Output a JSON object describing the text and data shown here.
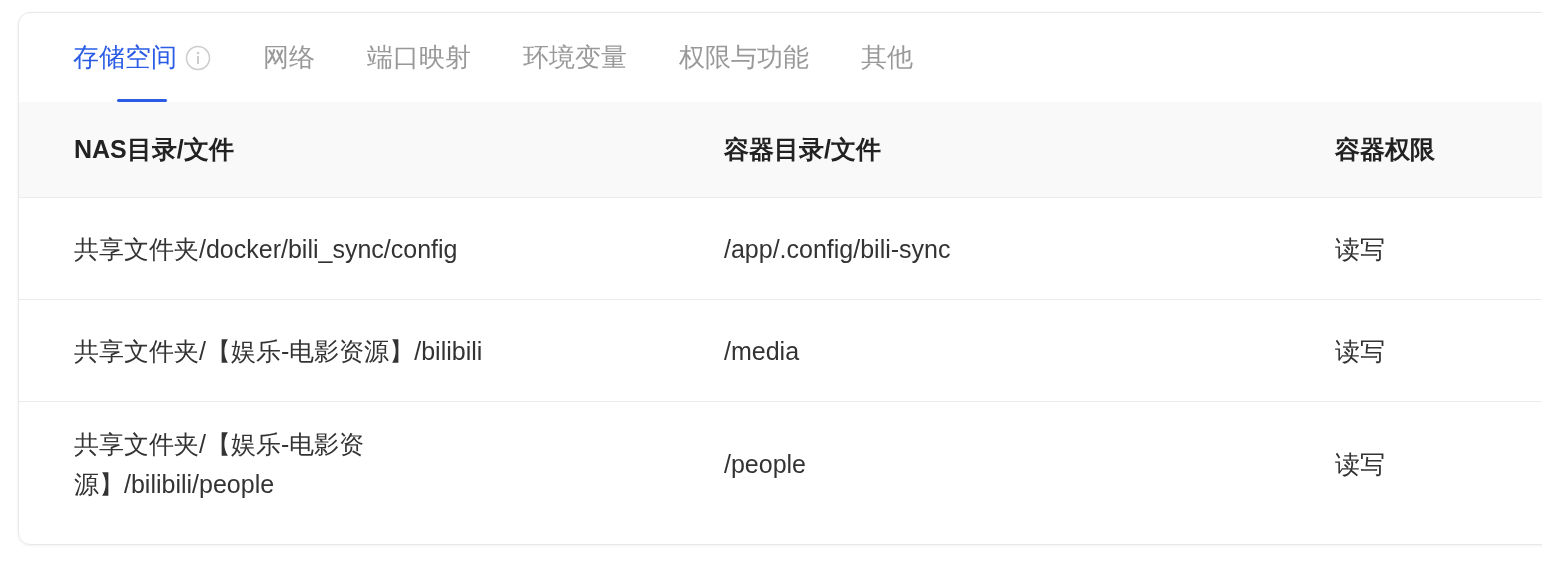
{
  "tabs": [
    {
      "label": "存储空间",
      "selected": true,
      "info": true
    },
    {
      "label": "网络",
      "selected": false
    },
    {
      "label": "端口映射",
      "selected": false
    },
    {
      "label": "环境变量",
      "selected": false
    },
    {
      "label": "权限与功能",
      "selected": false
    },
    {
      "label": "其他",
      "selected": false
    }
  ],
  "table": {
    "columns": [
      "NAS目录/文件",
      "容器目录/文件",
      "容器权限"
    ],
    "rows": [
      [
        "共享文件夹/docker/bili_sync/config",
        "/app/.config/bili-sync",
        "读写"
      ],
      [
        "共享文件夹/【娱乐-电影资源】/bilibili",
        "/media",
        "读写"
      ],
      [
        "共享文件夹/【娱乐-电影资源】/bilibili/people",
        "/people",
        "读写"
      ]
    ]
  }
}
